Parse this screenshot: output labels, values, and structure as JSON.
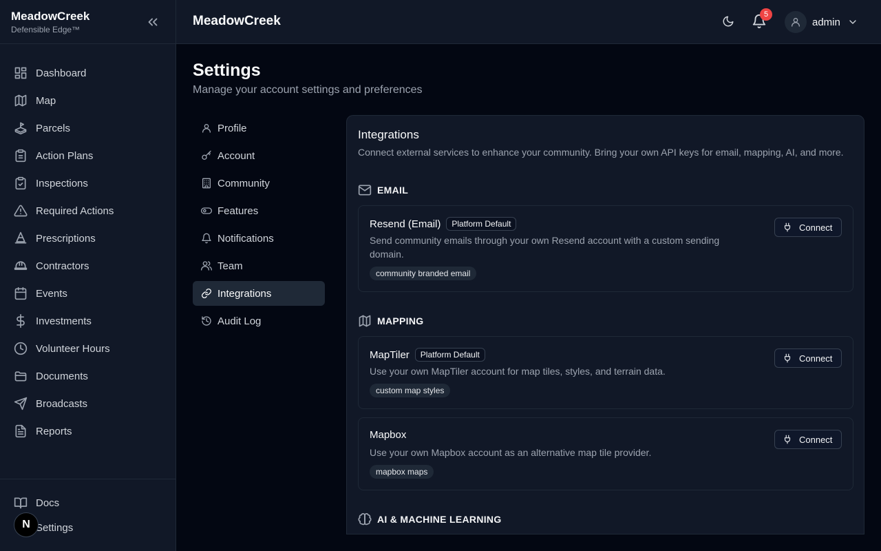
{
  "sidebar": {
    "brand_name": "MeadowCreek",
    "brand_sub": "Defensible Edge™",
    "items": [
      {
        "label": "Dashboard",
        "icon": "dashboard-icon"
      },
      {
        "label": "Map",
        "icon": "map-icon"
      },
      {
        "label": "Parcels",
        "icon": "parcels-icon"
      },
      {
        "label": "Action Plans",
        "icon": "clipboard-icon"
      },
      {
        "label": "Inspections",
        "icon": "clipboard-check-icon"
      },
      {
        "label": "Required Actions",
        "icon": "alert-triangle-icon"
      },
      {
        "label": "Prescriptions",
        "icon": "cone-icon"
      },
      {
        "label": "Contractors",
        "icon": "hard-hat-icon"
      },
      {
        "label": "Events",
        "icon": "calendar-icon"
      },
      {
        "label": "Investments",
        "icon": "dollar-icon"
      },
      {
        "label": "Volunteer Hours",
        "icon": "clock-icon"
      },
      {
        "label": "Documents",
        "icon": "folder-icon"
      },
      {
        "label": "Broadcasts",
        "icon": "send-icon"
      },
      {
        "label": "Reports",
        "icon": "file-text-icon"
      }
    ],
    "bottom_items": [
      {
        "label": "Docs",
        "icon": "book-icon"
      },
      {
        "label": "Settings",
        "icon": "gear-icon"
      }
    ],
    "dev_badge": "N"
  },
  "header": {
    "title": "MeadowCreek",
    "notification_count": "5",
    "user_name": "admin"
  },
  "page": {
    "title": "Settings",
    "subtitle": "Manage your account settings and preferences"
  },
  "settings_nav": [
    {
      "label": "Profile",
      "icon": "user-icon",
      "active": false
    },
    {
      "label": "Account",
      "icon": "key-icon",
      "active": false
    },
    {
      "label": "Community",
      "icon": "building-icon",
      "active": false
    },
    {
      "label": "Features",
      "icon": "toggle-icon",
      "active": false
    },
    {
      "label": "Notifications",
      "icon": "bell-icon",
      "active": false
    },
    {
      "label": "Team",
      "icon": "users-icon",
      "active": false
    },
    {
      "label": "Integrations",
      "icon": "link-icon",
      "active": true
    },
    {
      "label": "Audit Log",
      "icon": "history-icon",
      "active": false
    }
  ],
  "integrations": {
    "title": "Integrations",
    "description": "Connect external services to enhance your community. Bring your own API keys for email, mapping, AI, and more.",
    "sections": {
      "email": "EMAIL",
      "mapping": "MAPPING",
      "ai": "AI & MACHINE LEARNING"
    },
    "cards": [
      {
        "name": "Resend (Email)",
        "badge": "Platform Default",
        "description": "Send community emails through your own Resend account with a custom sending domain.",
        "tag": "community branded email",
        "button": "Connect"
      },
      {
        "name": "MapTiler",
        "badge": "Platform Default",
        "description": "Use your own MapTiler account for map tiles, styles, and terrain data.",
        "tag": "custom map styles",
        "button": "Connect"
      },
      {
        "name": "Mapbox",
        "badge": "",
        "description": "Use your own Mapbox account as an alternative map tile provider.",
        "tag": "mapbox maps",
        "button": "Connect"
      }
    ]
  },
  "colors": {
    "background": "#030712",
    "surface": "#111827",
    "border": "#1f2937",
    "active_nav": "#1f2937",
    "notification_badge": "#ef4444"
  }
}
